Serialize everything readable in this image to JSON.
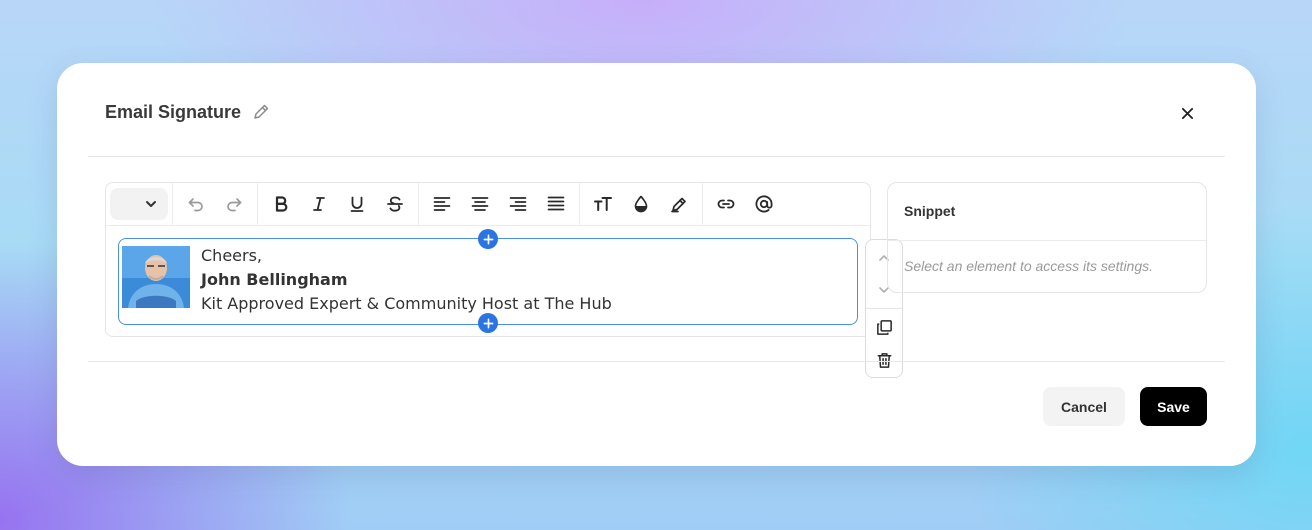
{
  "dialog": {
    "title": "Email Signature",
    "title_edit_icon": "pencil-icon",
    "close_icon": "close-icon"
  },
  "toolbar": {
    "block_type_select": {
      "value": "",
      "icon": "chevron-down-icon"
    },
    "history": [
      "undo-icon",
      "redo-icon"
    ],
    "formatting": [
      "bold-icon",
      "italic-icon",
      "underline-icon",
      "strikethrough-icon"
    ],
    "alignment": [
      "align-left-icon",
      "align-center-icon",
      "align-right-icon",
      "align-justify-icon"
    ],
    "style": [
      "font-size-icon",
      "text-color-icon",
      "highlight-icon"
    ],
    "insert": [
      "link-icon",
      "mention-icon"
    ]
  },
  "signature": {
    "greeting": "Cheers,",
    "name": "John Bellingham",
    "role": "Kit Approved Expert & Community Host at The Hub",
    "photo": "avatar-photo"
  },
  "block_tools": [
    "move-up-icon",
    "move-down-icon",
    "duplicate-icon",
    "delete-icon"
  ],
  "snippet": {
    "title": "Snippet",
    "hint": "Select an element to access its settings."
  },
  "footer": {
    "cancel_label": "Cancel",
    "save_label": "Save"
  },
  "colors": {
    "accent": "#2b75e3",
    "selection_border": "#4a90e2",
    "primary_button": "#000000"
  }
}
